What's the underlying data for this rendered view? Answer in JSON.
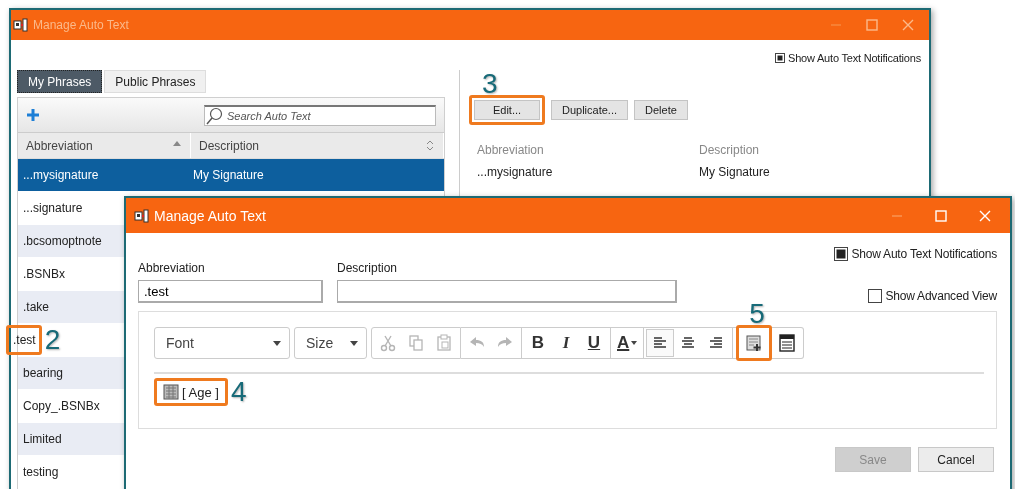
{
  "back_window": {
    "title": "Manage Auto Text",
    "notifications": {
      "label": "Show Auto Text Notifications",
      "checked": true
    },
    "tabs": [
      {
        "label": "My Phrases",
        "selected": true
      },
      {
        "label": "Public Phrases",
        "selected": false
      }
    ],
    "search": {
      "placeholder": "Search Auto Text"
    },
    "table": {
      "columns": [
        {
          "label": "Abbreviation",
          "kind": "ascending"
        },
        {
          "label": "Description",
          "kind": "sortable"
        }
      ],
      "rows": [
        {
          "abbreviation": "...mysignature",
          "description": "My Signature",
          "selected": true
        },
        {
          "abbreviation": "...signature",
          "selected": false
        },
        {
          "abbreviation": ".bcsomoptnote",
          "selected": false
        },
        {
          "abbreviation": ".BSNBx",
          "selected": false
        },
        {
          "abbreviation": ".take",
          "selected": false
        },
        {
          "abbreviation": ".test",
          "selected": false,
          "callout": "2"
        },
        {
          "abbreviation": "bearing",
          "selected": false
        },
        {
          "abbreviation": "Copy_.BSNBx",
          "selected": false
        },
        {
          "abbreviation": "Limited",
          "selected": false
        },
        {
          "abbreviation": "testing",
          "selected": false
        }
      ]
    },
    "buttons": [
      {
        "label": "Edit...",
        "callout": "3"
      },
      {
        "label": "Duplicate..."
      },
      {
        "label": "Delete"
      }
    ],
    "details": [
      {
        "label": "Abbreviation",
        "value": "...mysignature"
      },
      {
        "label": "Description",
        "value": "My Signature"
      }
    ]
  },
  "front_window": {
    "title": "Manage Auto Text",
    "notifications": {
      "label": "Show Auto Text Notifications",
      "checked": true
    },
    "advanced_view": {
      "label": "Show Advanced View",
      "checked": false
    },
    "fields": [
      {
        "label": "Abbreviation",
        "value": ".test"
      },
      {
        "label": "Description"
      }
    ],
    "toolbar": {
      "font": "Font",
      "size": "Size",
      "groups": [
        [
          {
            "kind": "cut",
            "disabled": true
          },
          {
            "kind": "copy",
            "disabled": true
          },
          {
            "kind": "paste",
            "disabled": true
          }
        ],
        [
          {
            "kind": "undo",
            "disabled": true
          },
          {
            "kind": "redo",
            "disabled": true
          }
        ],
        [
          {
            "kind": "bold",
            "label": "B",
            "disabled": false
          },
          {
            "kind": "italic",
            "label": "I",
            "disabled": false
          },
          {
            "kind": "underline",
            "label": "U",
            "disabled": false
          }
        ],
        [
          {
            "kind": "font_color",
            "label": "A",
            "disabled": false
          }
        ],
        [
          {
            "kind": "align_left",
            "disabled": false,
            "selected": true
          },
          {
            "kind": "align_center",
            "disabled": false,
            "selected": false
          },
          {
            "kind": "align_right",
            "disabled": false,
            "selected": false
          }
        ],
        [
          {
            "kind": "insert_field",
            "callout": "5"
          },
          {
            "kind": "template"
          }
        ]
      ]
    },
    "content": {
      "field": "[ Age ]",
      "callout": "4"
    },
    "buttons": [
      {
        "label": "Save",
        "disabled": true
      },
      {
        "label": "Cancel",
        "disabled": false
      }
    ]
  }
}
